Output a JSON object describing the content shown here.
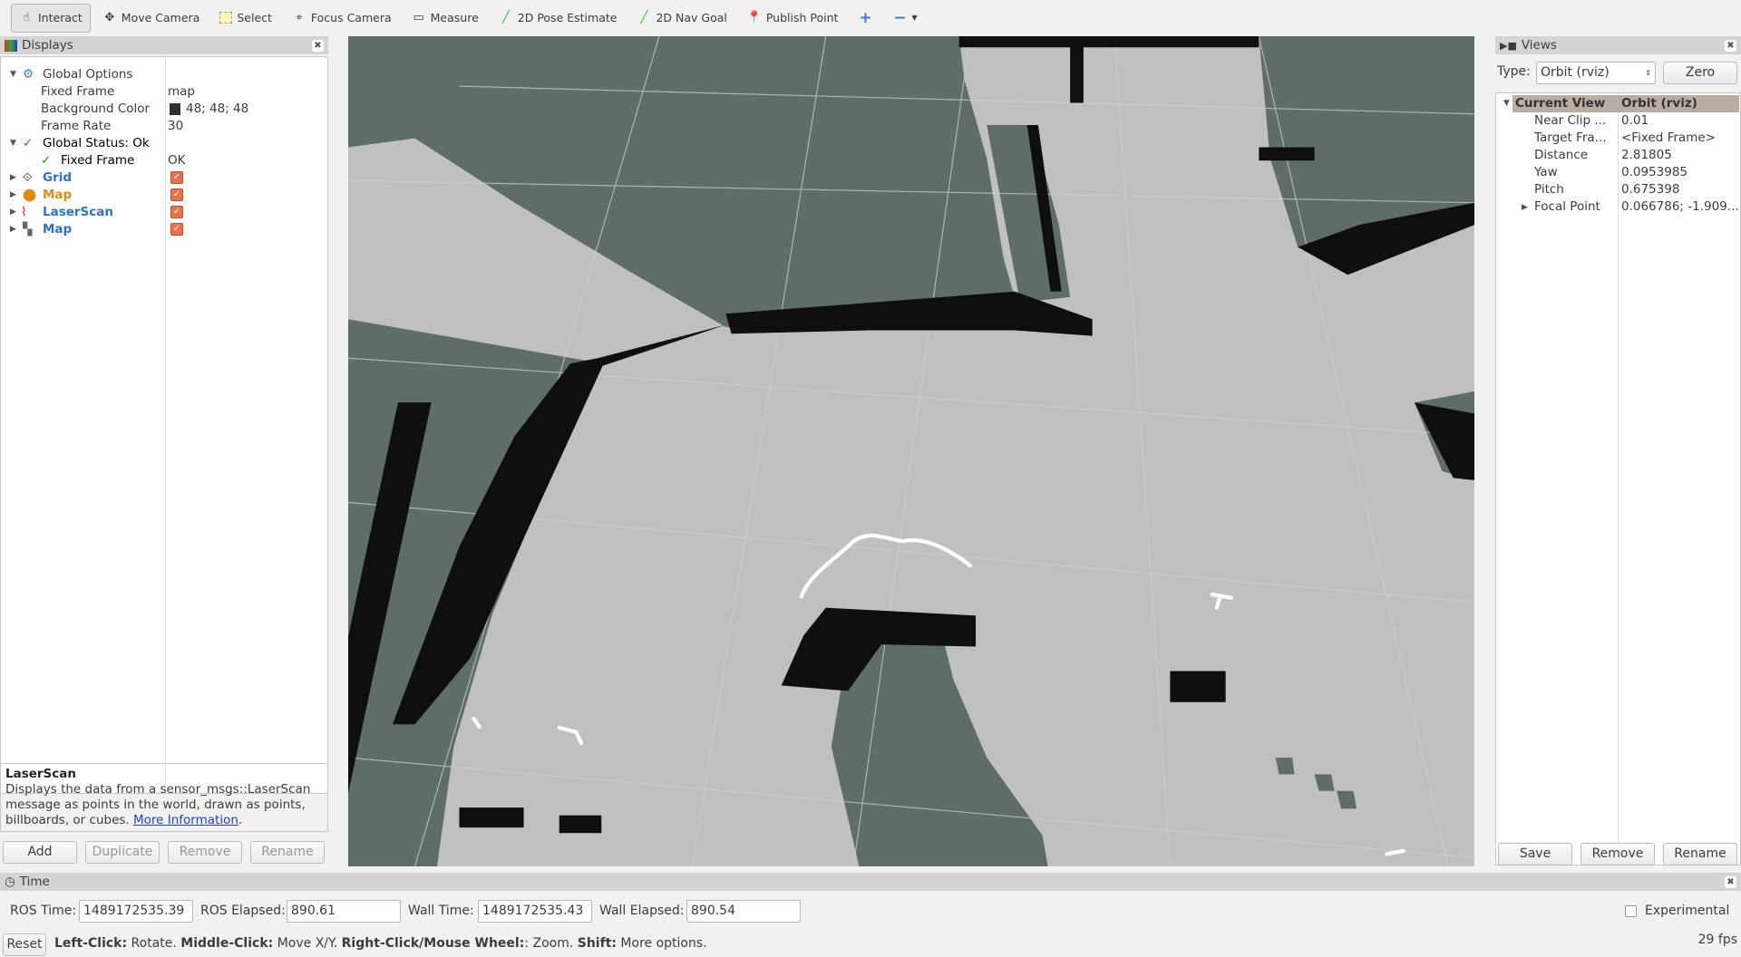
{
  "toolbar": {
    "tools": [
      "Interact",
      "Move Camera",
      "Select",
      "Focus Camera",
      "Measure",
      "2D Pose Estimate",
      "2D Nav Goal",
      "Publish Point"
    ]
  },
  "displays": {
    "title": "Displays",
    "rows": [
      {
        "k": "Global Options",
        "v": ""
      },
      {
        "k": "Fixed Frame",
        "v": "map"
      },
      {
        "k": "Background Color",
        "v": "48; 48; 48"
      },
      {
        "k": "Frame Rate",
        "v": "30"
      },
      {
        "k": "Global Status: Ok",
        "v": ""
      },
      {
        "k": "Fixed Frame",
        "v": "OK"
      },
      {
        "k": "Grid",
        "v": ""
      },
      {
        "k": "Map",
        "v": ""
      },
      {
        "k": "LaserScan",
        "v": ""
      },
      {
        "k": "Map",
        "v": ""
      }
    ],
    "desc_title": "LaserScan",
    "desc_text": "Displays the data from a sensor_msgs::LaserScan message as points in the world, drawn as points, billboards, or cubes. ",
    "desc_link": "More Information",
    "desc_end": ".",
    "buttons": [
      "Add",
      "Duplicate",
      "Remove",
      "Rename"
    ]
  },
  "views": {
    "title": "Views",
    "type_label": "Type:",
    "type_value": "Orbit (rviz)",
    "zero": "Zero",
    "header_k": "Current View",
    "header_v": "Orbit (rviz)",
    "rows": [
      {
        "k": "Near Clip ...",
        "v": "0.01"
      },
      {
        "k": "Target Fra...",
        "v": "<Fixed Frame>"
      },
      {
        "k": "Distance",
        "v": "2.81805"
      },
      {
        "k": "Yaw",
        "v": "0.0953985"
      },
      {
        "k": "Pitch",
        "v": "0.675398"
      },
      {
        "k": "Focal Point",
        "v": "0.066786; -1.909..."
      }
    ],
    "buttons": [
      "Save",
      "Remove",
      "Rename"
    ]
  },
  "time": {
    "title": "Time",
    "ros_time_label": "ROS Time:",
    "ros_time": "1489172535.39",
    "ros_elapsed_label": "ROS Elapsed:",
    "ros_elapsed": "890.61",
    "wall_time_label": "Wall Time:",
    "wall_time": "1489172535.43",
    "wall_elapsed_label": "Wall Elapsed:",
    "wall_elapsed": "890.54",
    "experimental": "Experimental"
  },
  "status": {
    "reset": "Reset",
    "b1": "Left-Click:",
    "t1": " Rotate. ",
    "b2": "Middle-Click:",
    "t2": " Move X/Y. ",
    "b3": "Right-Click/Mouse Wheel:",
    "t3": ": Zoom. ",
    "b4": "Shift:",
    "t4": " More options.",
    "fps": "29 fps"
  },
  "colors": {
    "floor_light": "#c0c0c0",
    "floor_dark": "#5e6d6a",
    "obstacle": "#0f0f0f",
    "header_highlight": "#b9aca3"
  }
}
